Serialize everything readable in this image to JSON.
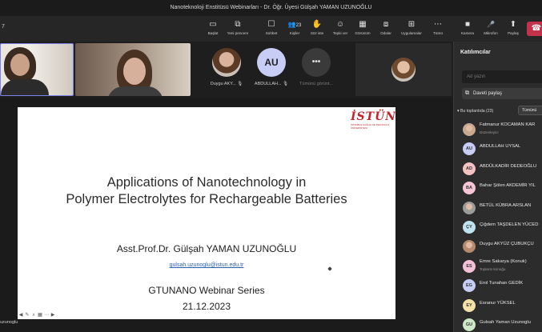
{
  "window": {
    "title": "Nanoteknoloji Enstitüsü Webinarları - Dr. Öğr. Üyesi Gülşah YAMAN UZUNOĞLU"
  },
  "toolbar": {
    "timer": "7",
    "buttons": [
      {
        "label": "Başlat",
        "icon": "screen-icon",
        "glyph": "▭"
      },
      {
        "label": "Yeni pencere",
        "icon": "new-window-icon",
        "glyph": "⧉"
      },
      {
        "label": "Sohbet",
        "icon": "chat-icon",
        "glyph": "☐"
      },
      {
        "label": "Kişiler",
        "icon": "people-icon",
        "glyph": "👥",
        "badge": "23"
      },
      {
        "label": "Söz iste",
        "icon": "raise-hand-icon",
        "glyph": "✋"
      },
      {
        "label": "Tepki ver",
        "icon": "reaction-icon",
        "glyph": "☺"
      },
      {
        "label": "Görünüm",
        "icon": "view-icon",
        "glyph": "▦"
      },
      {
        "label": "Odalar",
        "icon": "rooms-icon",
        "glyph": "⧈"
      },
      {
        "label": "Uygulamalar",
        "icon": "apps-icon",
        "glyph": "⊞"
      },
      {
        "label": "Tümü",
        "icon": "more-icon",
        "glyph": "⋯"
      },
      {
        "label": "Kamera",
        "icon": "camera-icon",
        "glyph": "■"
      },
      {
        "label": "Mikrofon",
        "icon": "mic-icon",
        "glyph": "🎤"
      },
      {
        "label": "Paylaş",
        "icon": "share-icon",
        "glyph": "⬆"
      }
    ],
    "leave_glyph": "☎"
  },
  "videos": {
    "tiles": [
      {
        "name": "Duygu AKY...",
        "mic": "🎙"
      },
      {
        "name": "ABDULLAH...",
        "initials": "AU",
        "mic": "🎙"
      },
      {
        "name": "Tümünü görünt..."
      }
    ]
  },
  "slide": {
    "logo_text": "İSTÜN",
    "logo_sub": "İSTANBUL SAĞLIK VE TEKNOLOJİ ÜNİVERSİTESİ",
    "title_line1": "Applications of Nanotechnology in",
    "title_line2": "Polymer Electrolytes for Rechargeable Batteries",
    "author": "Asst.Prof.Dr. Gülşah YAMAN UZUNOĞLU",
    "email": "gulsah.uzunoglu@istun.edu.tr",
    "series": "GTUNANO Webinar Series",
    "date": "21.12.2023",
    "bottom_label": "uzunoglu"
  },
  "panel": {
    "title": "Katılımcılar",
    "search_placeholder": "Ad yazın",
    "invite_label": "Daveti paylaş",
    "section": "Bu toplantıda (23)",
    "mute_all": "Tümünü",
    "participants": [
      {
        "name": "Fatmanur KOCAMAN KAR",
        "role": "Düzenleyici",
        "initials": "",
        "color": "#c9a890"
      },
      {
        "name": "ABDULLAH UYSAL",
        "role": "",
        "initials": "AU",
        "color": "#c8cdf6"
      },
      {
        "name": "ABDÜLKADİR DEDEOĞLU",
        "role": "",
        "initials": "AD",
        "color": "#f4c2c2"
      },
      {
        "name": "Bahar Şölen AKDEMİR YIL",
        "role": "",
        "initials": "BA",
        "color": "#f6c6d6"
      },
      {
        "name": "BETÜL KÜBRA ARSLAN",
        "role": "",
        "initials": "",
        "color": "#9c9c9c"
      },
      {
        "name": "Çiğdem TAŞDELEN YÜCED",
        "role": "",
        "initials": "ÇY",
        "color": "#bfe3ef"
      },
      {
        "name": "Duygu AKYÜZ ÇUBUKÇU",
        "role": "",
        "initials": "",
        "color": "#b58a6e"
      },
      {
        "name": "Emre Sakarya (Konuk)",
        "role": "Toplantı konuğu",
        "initials": "ES",
        "color": "#f3c0d8"
      },
      {
        "name": "Erol Tunahan GEDİK",
        "role": "",
        "initials": "EG",
        "color": "#c8cdf6"
      },
      {
        "name": "Esranur YÜKSEL",
        "role": "",
        "initials": "EY",
        "color": "#f5e2a8"
      },
      {
        "name": "Gulsah Yaman Uzunoglu",
        "role": "",
        "initials": "GU",
        "color": "#cfe8c8"
      }
    ]
  }
}
